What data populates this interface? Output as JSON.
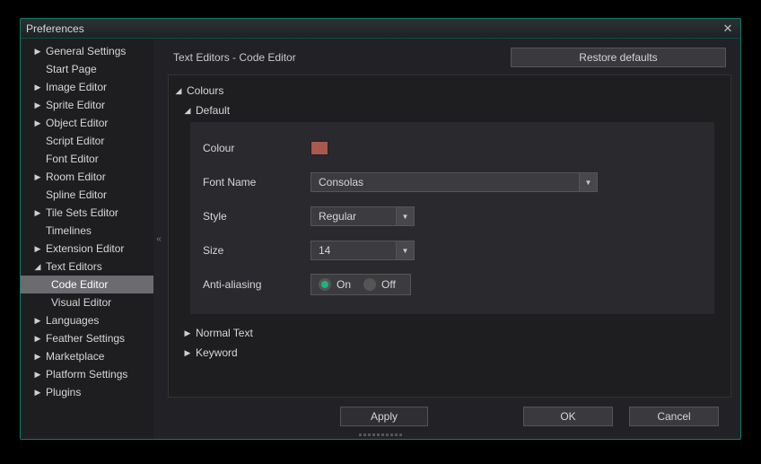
{
  "window": {
    "title": "Preferences"
  },
  "sidebar": {
    "items": [
      {
        "label": "General Settings",
        "arrow": "right",
        "indent": 1
      },
      {
        "label": "Start Page",
        "arrow": "",
        "indent": 1
      },
      {
        "label": "Image Editor",
        "arrow": "right",
        "indent": 1
      },
      {
        "label": "Sprite Editor",
        "arrow": "right",
        "indent": 1
      },
      {
        "label": "Object Editor",
        "arrow": "right",
        "indent": 1
      },
      {
        "label": "Script Editor",
        "arrow": "",
        "indent": 1
      },
      {
        "label": "Font Editor",
        "arrow": "",
        "indent": 1
      },
      {
        "label": "Room Editor",
        "arrow": "right",
        "indent": 1
      },
      {
        "label": "Spline Editor",
        "arrow": "",
        "indent": 1
      },
      {
        "label": "Tile Sets Editor",
        "arrow": "right",
        "indent": 1
      },
      {
        "label": "Timelines",
        "arrow": "",
        "indent": 1
      },
      {
        "label": "Extension Editor",
        "arrow": "right",
        "indent": 1
      },
      {
        "label": "Text Editors",
        "arrow": "down",
        "indent": 1
      },
      {
        "label": "Code Editor",
        "arrow": "",
        "indent": 2,
        "selected": true
      },
      {
        "label": "Visual Editor",
        "arrow": "",
        "indent": 2
      },
      {
        "label": "Languages",
        "arrow": "right",
        "indent": 1
      },
      {
        "label": "Feather Settings",
        "arrow": "right",
        "indent": 1
      },
      {
        "label": "Marketplace",
        "arrow": "right",
        "indent": 1
      },
      {
        "label": "Platform Settings",
        "arrow": "right",
        "indent": 1
      },
      {
        "label": "Plugins",
        "arrow": "right",
        "indent": 1
      }
    ]
  },
  "main": {
    "breadcrumb": "Text Editors - Code Editor",
    "restore_label": "Restore defaults",
    "sections": {
      "colours": "Colours",
      "default": "Default",
      "normal_text": "Normal Text",
      "keyword": "Keyword"
    },
    "form": {
      "colour_label": "Colour",
      "colour_value": "#a85a4f",
      "font_label": "Font Name",
      "font_value": "Consolas",
      "style_label": "Style",
      "style_value": "Regular",
      "size_label": "Size",
      "size_value": "14",
      "aa_label": "Anti-aliasing",
      "aa_on": "On",
      "aa_off": "Off"
    }
  },
  "footer": {
    "apply": "Apply",
    "ok": "OK",
    "cancel": "Cancel"
  }
}
